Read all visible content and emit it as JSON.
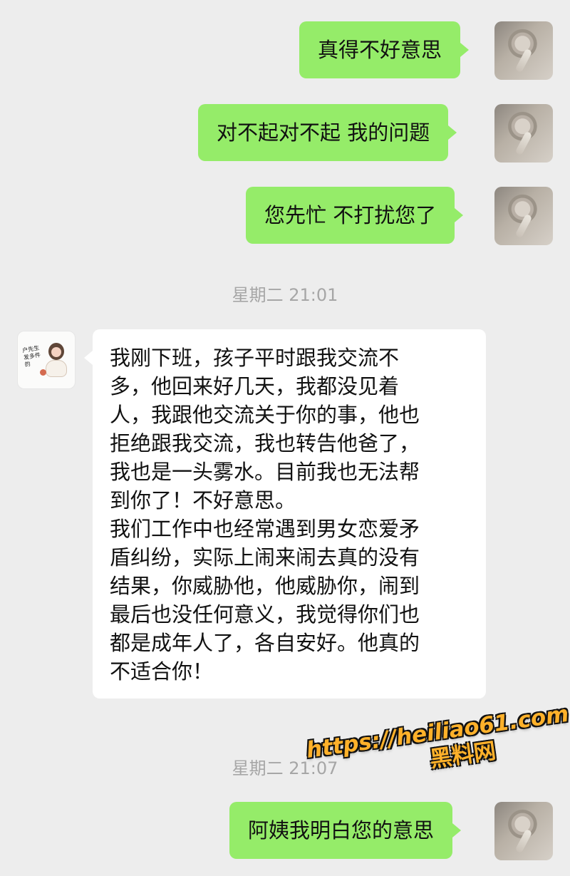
{
  "conversation": [
    {
      "type": "message",
      "from": "me",
      "text": "真得不好意思"
    },
    {
      "type": "message",
      "from": "me",
      "text": "对不起对不起 我的问题"
    },
    {
      "type": "message",
      "from": "me",
      "text": "您先忙 不打扰您了"
    },
    {
      "type": "timestamp",
      "text": "星期二 21:01"
    },
    {
      "type": "message",
      "from": "other",
      "lines": [
        "我刚下班，孩子平时跟我交流不",
        "多，他回来好几天，我都没见着",
        "人，我跟他交流关于你的事，他也",
        "拒绝跟我交流，我也转告他爸了，",
        "我也是一头雾水。目前我也无法帮",
        "到你了！不好意思。",
        "我们工作中也经常遇到男女恋爱矛",
        "盾纠纷，实际上闹来闹去真的没有",
        "结果，你威胁他，他威胁你，闹到",
        "最后也没任何意义，我觉得你们也",
        "都是成年人了，各自安好。他真的",
        "不适合你！"
      ]
    },
    {
      "type": "timestamp",
      "text": "星期二 21:07"
    },
    {
      "type": "message",
      "from": "me",
      "text": "阿姨我明白您的意思"
    }
  ],
  "watermark": {
    "url": "https://heiliao61.com",
    "label": "黑料网"
  },
  "other_avatar_text": "户先生\n发多件的"
}
